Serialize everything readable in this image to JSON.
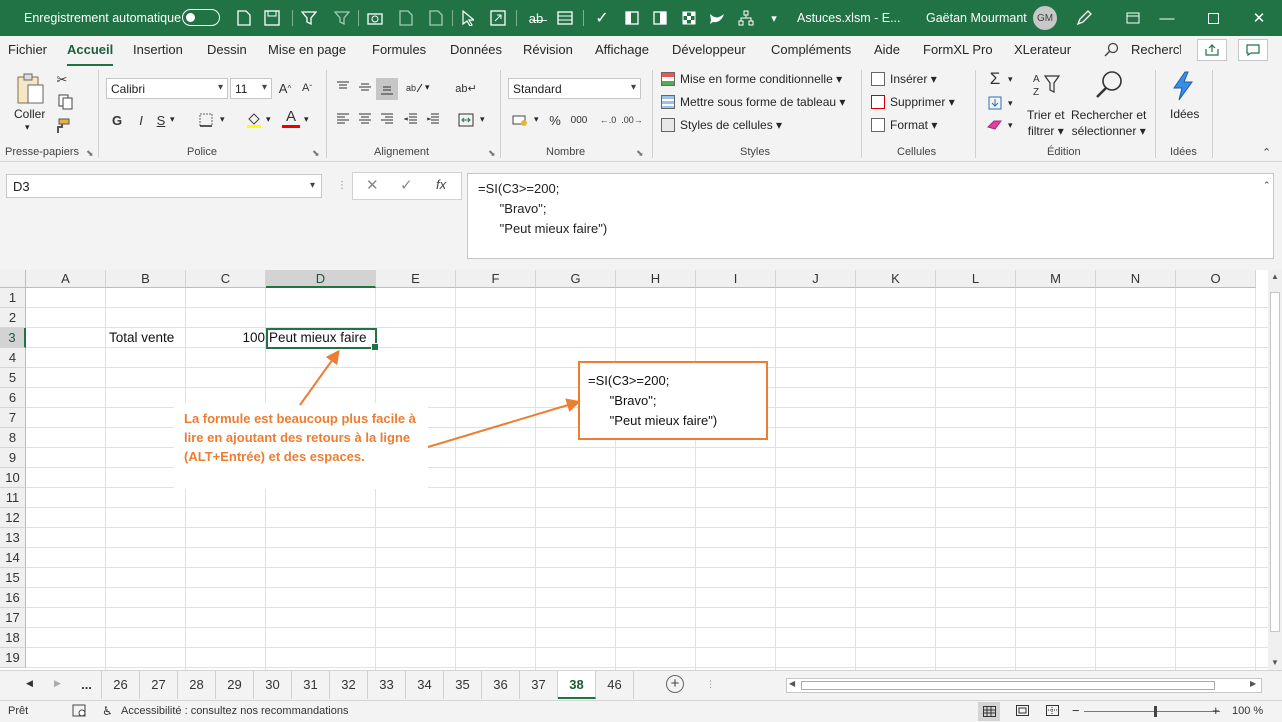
{
  "titlebar": {
    "autosave_label": "Enregistrement automatique",
    "filename": "Astuces.xlsm  -  E...",
    "user": "Gaëtan Mourmant",
    "user_initials": "GM"
  },
  "menu": {
    "tabs": [
      "Fichier",
      "Accueil",
      "Insertion",
      "Dessin",
      "Mise en page",
      "Formules",
      "Données",
      "Révision",
      "Affichage",
      "Développeur",
      "Compléments",
      "Aide",
      "FormXL Pro",
      "XLerateur"
    ],
    "search_label": "Rechercħ",
    "active_tab": "Accueil"
  },
  "ribbon": {
    "clipboard": {
      "paste_label": "Coller",
      "group": "Presse-papiers"
    },
    "police": {
      "font": "Calibri",
      "size": "11",
      "bold": "G",
      "italic": "I",
      "underline": "S",
      "group": "Police"
    },
    "alignement": {
      "group": "Alignement"
    },
    "nombre": {
      "format": "Standard",
      "group": "Nombre"
    },
    "styles": {
      "cond_format": "Mise en forme conditionnelle",
      "table_format": "Mettre sous forme de tableau",
      "cell_styles": "Styles de cellules",
      "group": "Styles"
    },
    "cellules": {
      "insert": "Insérer",
      "delete": "Supprimer",
      "format": "Format",
      "group": "Cellules"
    },
    "edition": {
      "sort_line1": "Trier et",
      "sort_line2": "filtrer",
      "find_line1": "Rechercher et",
      "find_line2": "sélectionner",
      "group": "Édition"
    },
    "idees": {
      "label": "Idées",
      "group": "Idées"
    }
  },
  "formula_bar": {
    "name_box": "D3",
    "fx": "fx",
    "formula": "=SI(C3>=200;\n      \"Bravo\";\n      \"Peut mieux faire\")"
  },
  "grid": {
    "columns": [
      "A",
      "B",
      "C",
      "D",
      "E",
      "F",
      "G",
      "H",
      "I",
      "J",
      "K",
      "L",
      "M",
      "N",
      "O"
    ],
    "rows": [
      "1",
      "2",
      "3",
      "4",
      "5",
      "6",
      "7",
      "8",
      "9",
      "10",
      "11",
      "12",
      "13",
      "14",
      "15",
      "16",
      "17",
      "18",
      "19"
    ],
    "selected_column": "D",
    "selected_row": "3",
    "cells": {
      "b3": "Total vente",
      "c3": "100",
      "d3": "Peut mieux faire"
    }
  },
  "annotation": {
    "note": "La formule est beaucoup plus facile à lire en ajoutant des retours à la ligne (ALT+Entrée) et des espaces.",
    "callout": "=SI(C3>=200;\n      \"Bravo\";\n      \"Peut mieux faire\")",
    "accent_color": "#ed7d31"
  },
  "sheets": {
    "ellipsis": "...",
    "tabs": [
      "26",
      "27",
      "28",
      "29",
      "30",
      "31",
      "32",
      "33",
      "34",
      "35",
      "36",
      "37",
      "38",
      "46"
    ],
    "active": "38"
  },
  "status": {
    "ready": "Prêt",
    "accessibility": "Accessibilité : consultez nos recommandations",
    "zoom": "100 %"
  },
  "colors": {
    "brand": "#217346"
  }
}
